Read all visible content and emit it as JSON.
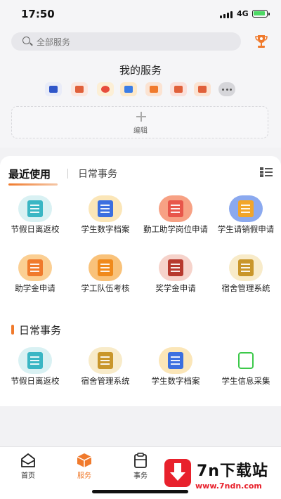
{
  "status": {
    "time": "17:50",
    "network": "4G"
  },
  "search": {
    "placeholder": "全部服务"
  },
  "my_services": {
    "title": "我的服务",
    "edit_label": "编辑",
    "mini_icons": [
      {
        "name": "megaphone-icon",
        "color": "#2f56c9"
      },
      {
        "name": "document-icon",
        "color": "#e0603a"
      },
      {
        "name": "camera-icon",
        "color": "#f0a11f"
      },
      {
        "name": "bag-icon",
        "color": "#3b7de6"
      },
      {
        "name": "card-icon",
        "color": "#f07a2c"
      },
      {
        "name": "certificate-icon",
        "color": "#e0603a"
      },
      {
        "name": "id-card-icon",
        "color": "#e0603a"
      },
      {
        "name": "more-icon",
        "color": "#d6d6da"
      }
    ]
  },
  "tabs": {
    "recent": "最近使用",
    "daily": "日常事务"
  },
  "recent_items": [
    {
      "label": "节假日离返校",
      "icon": "leave-form-icon",
      "color": "#3ab6c4"
    },
    {
      "label": "学生数字档案",
      "icon": "archive-icon",
      "color": "#3b6fe0"
    },
    {
      "label": "勤工助学岗位申请",
      "icon": "work-study-icon",
      "color": "#e8564a"
    },
    {
      "label": "学生请销假申请",
      "icon": "bag-icon",
      "color": "#f2a52a"
    },
    {
      "label": "助学金申请",
      "icon": "grant-icon",
      "color": "#f07a2c"
    },
    {
      "label": "学工队伍考核",
      "icon": "checklist-icon",
      "color": "#f08a1c"
    },
    {
      "label": "奖学金申请",
      "icon": "scholarship-icon",
      "color": "#b7392e"
    },
    {
      "label": "宿舍管理系统",
      "icon": "dormitory-icon",
      "color": "#c9962a"
    }
  ],
  "daily_section": {
    "title": "日常事务",
    "items": [
      {
        "label": "节假日离返校",
        "icon": "leave-form-icon",
        "color": "#3ab6c4"
      },
      {
        "label": "宿舍管理系统",
        "icon": "dormitory-icon",
        "color": "#c9962a"
      },
      {
        "label": "学生数字档案",
        "icon": "archive-icon",
        "color": "#3b6fe0"
      },
      {
        "label": "学生信息采集",
        "icon": "info-collect-icon",
        "color": "#3cc94a"
      }
    ]
  },
  "tabbar": [
    {
      "label": "首页",
      "icon": "home-icon"
    },
    {
      "label": "服务",
      "icon": "service-box-icon",
      "active": true
    },
    {
      "label": "事务",
      "icon": "clipboard-icon"
    }
  ],
  "watermark": {
    "title": "7n下载站",
    "url": "www.7ndn.com"
  },
  "colors": {
    "accent": "#f07a2c",
    "background": "#f2f2f4"
  }
}
